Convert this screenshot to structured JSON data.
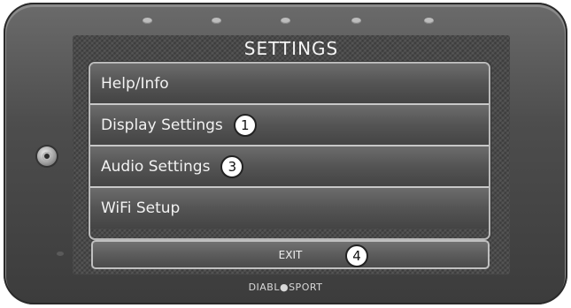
{
  "screen": {
    "title": "SETTINGS",
    "menu": [
      {
        "label": "Help/Info",
        "badge": ""
      },
      {
        "label": "Display Settings",
        "badge": "1"
      },
      {
        "label": "Audio Settings",
        "badge": "3"
      },
      {
        "label": "WiFi Setup",
        "badge": ""
      }
    ],
    "exit": {
      "label": "EXIT",
      "badge": "4"
    }
  },
  "device": {
    "brand": "DIABL●SPORT",
    "icons": {
      "home": "home-button-icon"
    }
  },
  "colors": {
    "bezel": "#4d4d4d",
    "menu_border": "#c0c0c0",
    "text": "#f2f2f2"
  }
}
